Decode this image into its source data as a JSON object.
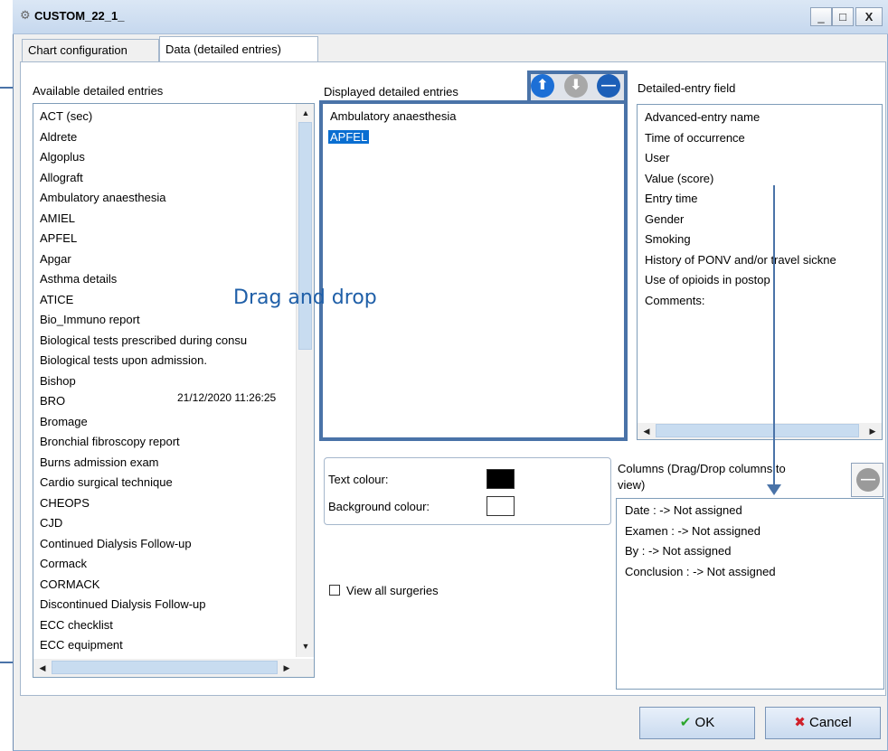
{
  "window": {
    "title": "CUSTOM_22_1_",
    "minimize": "_",
    "maximize": "□",
    "close": "X"
  },
  "tabs": [
    {
      "label": "Chart configuration"
    },
    {
      "label": "Data (detailed entries)"
    }
  ],
  "available": {
    "label": "Available detailed entries",
    "items": [
      "ACT (sec)",
      "Aldrete",
      "Algoplus",
      "Allograft",
      "Ambulatory anaesthesia",
      "AMIEL",
      "APFEL",
      "Apgar",
      "Asthma details",
      "ATICE",
      "Bio_Immuno report",
      "Biological tests prescribed during consu",
      "Biological tests upon admission.",
      "Bishop",
      "BRO",
      "Bromage",
      "Bronchial fibroscopy report",
      "Burns admission exam",
      "Cardio surgical technique",
      "CHEOPS",
      "CJD",
      "Continued Dialysis Follow-up",
      "Cormack",
      "CORMACK",
      "Discontinued Dialysis Follow-up",
      "ECC checklist",
      "ECC equipment"
    ],
    "timestamp": "21/12/2020 11:26:25"
  },
  "displayed": {
    "label": "Displayed detailed entries",
    "items": [
      "Ambulatory anaesthesia",
      "APFEL"
    ],
    "selected_index": 1
  },
  "fields": {
    "label": "Detailed-entry field",
    "items": [
      "Advanced-entry name",
      "Time of occurrence",
      "User",
      "Value (score)",
      "Entry time",
      "Gender",
      "Smoking",
      "History of PONV and/or travel sickne",
      "Use of opioids in postop",
      "Comments:"
    ]
  },
  "colours": {
    "text_label": "Text colour:",
    "text_value": "#000000",
    "background_label": "Background colour:",
    "background_value": "#ffffff"
  },
  "view_all": {
    "label": "View all surgeries",
    "checked": false
  },
  "columns": {
    "label_line1": "Columns (Drag/Drop columns to",
    "label_line2": "view)",
    "items": [
      "Date : -> Not assigned",
      "Examen : -> Not assigned",
      "By : -> Not assigned",
      "Conclusion : -> Not assigned"
    ]
  },
  "annotation": {
    "text": "Drag and drop"
  },
  "buttons": {
    "ok": "OK",
    "cancel": "Cancel"
  },
  "colors": {
    "accent": "#4a73a8",
    "selection": "#0a6ed1",
    "move_up": "#1c6fd6",
    "move_down": "#a8a8a8",
    "remove": "#1c5fb8"
  }
}
